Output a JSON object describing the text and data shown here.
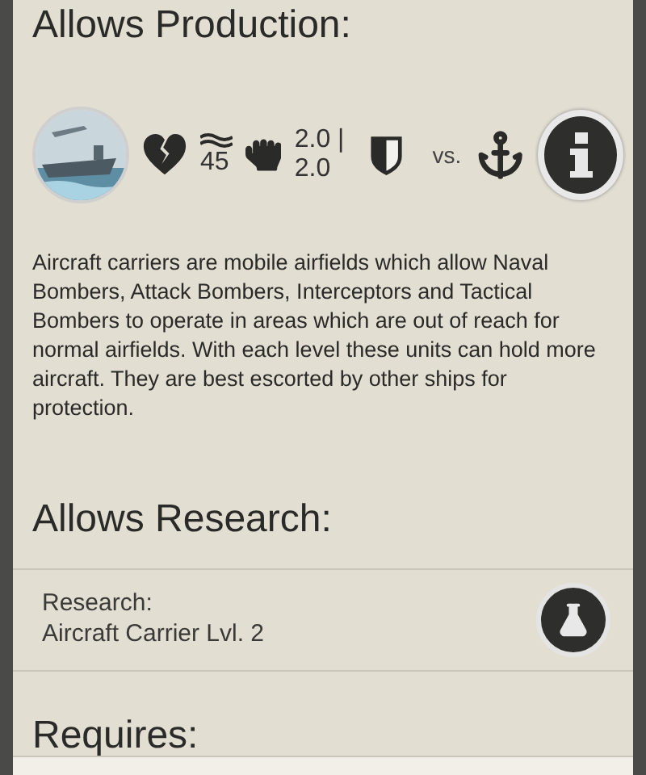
{
  "production": {
    "heading": "Allows Production:",
    "stats": [
      {
        "kind": "health"
      },
      {
        "kind": "speed",
        "lines": [
          "45"
        ]
      },
      {
        "kind": "attack",
        "lines": [
          "2.0 |",
          "2.0"
        ]
      },
      {
        "kind": "defense"
      },
      {
        "kind": "versus",
        "lines": [
          "vs."
        ]
      },
      {
        "kind": "naval"
      }
    ],
    "description": "Aircraft carriers are mobile airfields which allow Naval Bombers, Attack Bombers, Interceptors and Tactical Bombers to operate in areas which are out of reach for normal airfields. With each level these units can hold more aircraft. They are best escorted by other ships for protection."
  },
  "research": {
    "heading": "Allows Research:",
    "label": "Research:",
    "name": "Aircraft Carrier Lvl. 2"
  },
  "requires": {
    "heading": "Requires:"
  }
}
